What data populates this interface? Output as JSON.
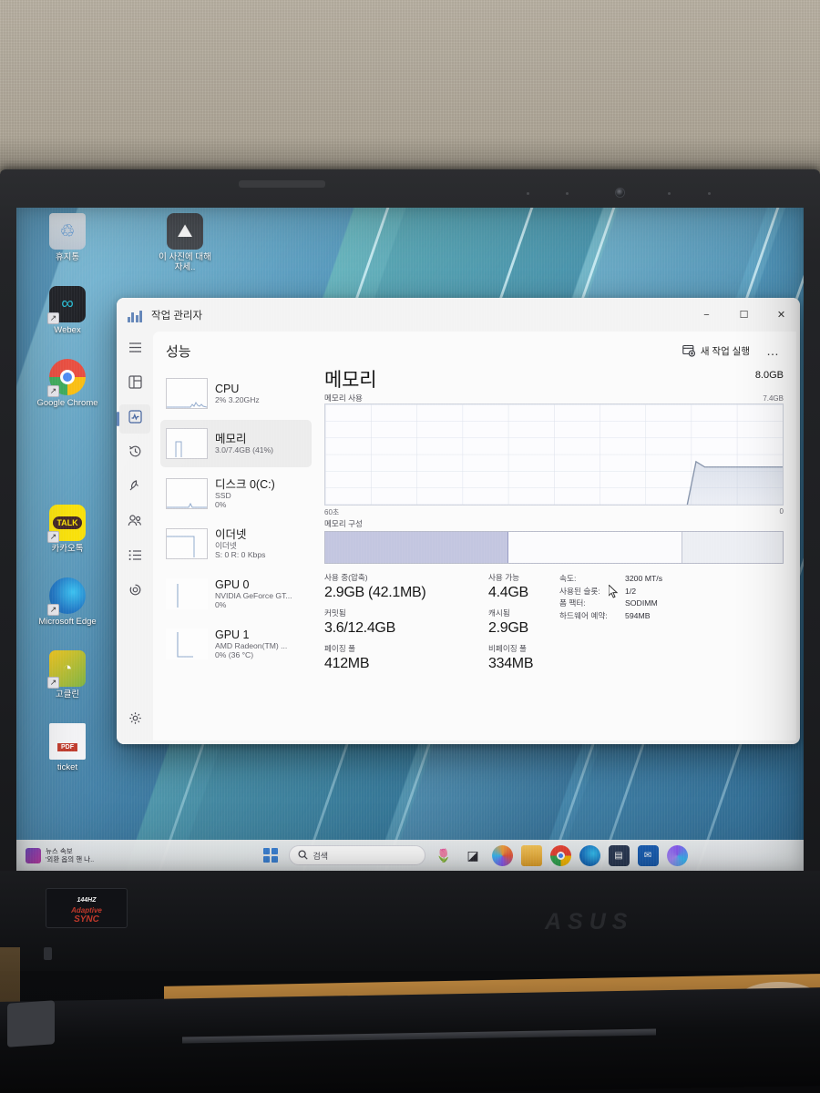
{
  "window": {
    "title": "작업 관리자",
    "app_icon": "task-manager-icon",
    "minimize": "−",
    "maximize": "☐",
    "close": "✕"
  },
  "nav_rail": [
    {
      "name": "hamburger-menu",
      "icon": "hamburger-icon"
    },
    {
      "name": "processes",
      "icon": "processes-icon"
    },
    {
      "name": "performance",
      "icon": "performance-icon",
      "selected": true
    },
    {
      "name": "app-history",
      "icon": "history-icon"
    },
    {
      "name": "startup-apps",
      "icon": "rocket-icon"
    },
    {
      "name": "users",
      "icon": "users-icon"
    },
    {
      "name": "details",
      "icon": "list-icon"
    },
    {
      "name": "services",
      "icon": "services-icon"
    },
    {
      "name": "settings",
      "icon": "gear-icon"
    }
  ],
  "pane": {
    "title": "성능",
    "new_task_label": "새 작업 실행",
    "new_task_icon": "new-task-icon",
    "more_options": "…"
  },
  "resources": [
    {
      "name": "CPU",
      "sub1": "",
      "sub2": "2% 3.20GHz",
      "selected": false
    },
    {
      "name": "메모리",
      "sub1": "",
      "sub2": "3.0/7.4GB (41%)",
      "selected": true
    },
    {
      "name": "디스크 0(C:)",
      "sub1": "SSD",
      "sub2": "0%",
      "selected": false
    },
    {
      "name": "이더넷",
      "sub1": "이더넷",
      "sub2": "S: 0 R: 0 Kbps",
      "selected": false
    },
    {
      "name": "GPU 0",
      "sub1": "NVIDIA GeForce GT...",
      "sub2": "0%",
      "selected": false
    },
    {
      "name": "GPU 1",
      "sub1": "AMD Radeon(TM) ...",
      "sub2": "0% (36 °C)",
      "selected": false
    }
  ],
  "memory": {
    "heading": "메모리",
    "capacity": "8.0GB",
    "graph_label": "메모리 사용",
    "graph_max": "7.4GB",
    "axis_left": "60초",
    "axis_right": "0",
    "composition_label": "메모리 구성",
    "stats": {
      "in_use_key": "사용 중(압축)",
      "in_use_val": "2.9GB (42.1MB)",
      "available_key": "사용 가능",
      "available_val": "4.4GB",
      "committed_key": "커밋됨",
      "committed_val": "3.6/12.4GB",
      "cached_key": "캐시됨",
      "cached_val": "2.9GB",
      "paged_key": "페이징 풀",
      "paged_val": "412MB",
      "nonpaged_key": "비페이징 풀",
      "nonpaged_val": "334MB"
    },
    "specs": [
      {
        "key": "속도:",
        "value": "3200 MT/s"
      },
      {
        "key": "사용된 슬롯:",
        "value": "1/2"
      },
      {
        "key": "폼 팩터:",
        "value": "SODIMM"
      },
      {
        "key": "하드웨어 예약:",
        "value": "594MB"
      }
    ]
  },
  "chart_data": {
    "type": "area",
    "title": "메모리 사용",
    "ylabel": "",
    "xlabel": "",
    "ylim": [
      0,
      7.4
    ],
    "xlim": [
      60,
      0
    ],
    "x_tick_labels": [
      "60초",
      "0"
    ],
    "y_max_label": "7.4GB",
    "grid": true,
    "series": [
      {
        "name": "메모리 사용",
        "unit": "GB",
        "x": [
          60,
          30,
          22,
          20,
          19,
          18,
          17,
          15,
          10,
          5,
          0
        ],
        "values": [
          0,
          0,
          0,
          0,
          2.3,
          3.1,
          2.9,
          2.9,
          2.9,
          2.9,
          2.9
        ]
      }
    ],
    "composition": {
      "type": "bar",
      "categories": [
        "사용 중",
        "사용 가능",
        "예약됨"
      ],
      "values": [
        40,
        38,
        22
      ],
      "unit": "%"
    }
  },
  "desktop": {
    "icons": [
      {
        "label": "휴지통",
        "icon": "recycle-bin-icon",
        "shortcut": false
      },
      {
        "label": "이 사진에 대해 자세..",
        "icon": "picture-info-icon",
        "shortcut": false
      },
      {
        "label": "Webex",
        "icon": "webex-icon",
        "shortcut": true
      },
      {
        "label": "Google Chrome",
        "icon": "chrome-icon",
        "shortcut": true
      },
      {
        "label": "카카오톡",
        "icon": "kakaotalk-icon",
        "shortcut": true
      },
      {
        "label": "Microsoft Edge",
        "icon": "edge-icon",
        "shortcut": true
      },
      {
        "label": "고클린",
        "icon": "goclean-icon",
        "shortcut": true
      },
      {
        "label": "ticket",
        "icon": "pdf-file-icon",
        "shortcut": false
      }
    ]
  },
  "taskbar": {
    "news_title": "뉴스 속보",
    "news_sub": "'외환 옵의 핸 나..",
    "news_icon": "news-icon",
    "start_icon": "windows-start-icon",
    "search_placeholder": "검색",
    "search_icon": "search-icon",
    "pinned": [
      {
        "name": "tulips-icon",
        "glyph": "🌷"
      },
      {
        "name": "task-view-icon",
        "glyph": "◣"
      },
      {
        "name": "copilot-icon",
        "glyph": "✦"
      },
      {
        "name": "file-explorer-icon",
        "glyph": "🗀"
      },
      {
        "name": "chrome-icon",
        "glyph": "◉"
      },
      {
        "name": "edge-icon",
        "glyph": "◕"
      },
      {
        "name": "store-icon",
        "glyph": "▤"
      },
      {
        "name": "outlook-icon",
        "glyph": "✉"
      },
      {
        "name": "copilot-alt-icon",
        "glyph": "◍"
      }
    ]
  },
  "hardware": {
    "sticker_line1": "144",
    "sticker_hz": "HZ",
    "sticker_line2": "Adaptive",
    "sticker_line3": "SYNC",
    "brand": "ASUS"
  }
}
